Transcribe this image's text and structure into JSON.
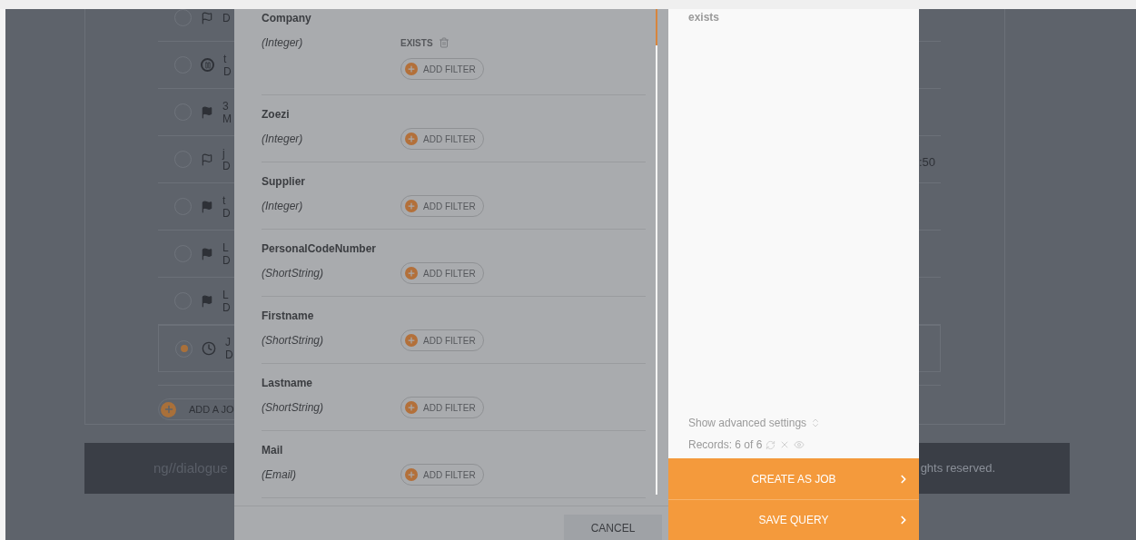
{
  "background_page": {
    "jobs": [
      {
        "kind": "flag",
        "selected": false,
        "subtitle": "D"
      },
      {
        "kind": "pause",
        "selected": false,
        "title": "t",
        "subtitle": "D"
      },
      {
        "kind": "checkered-flag",
        "selected": false,
        "title": "3",
        "subtitle": "M"
      },
      {
        "kind": "flag",
        "selected": false,
        "title": "j",
        "subtitle": "D"
      },
      {
        "kind": "checkered-flag",
        "selected": false,
        "title": "t",
        "subtitle": "D"
      },
      {
        "kind": "checkered-flag",
        "selected": false,
        "title": "L",
        "subtitle": "D"
      },
      {
        "kind": "checkered-flag",
        "selected": false,
        "title": "L",
        "subtitle": "D"
      },
      {
        "kind": "clock",
        "selected": true,
        "title": "J",
        "subtitle": "D"
      }
    ],
    "add_job_button": "ADD A JO",
    "time_fragment": ":50",
    "footer": {
      "logo": "ng//dialogue",
      "copyright": "ghts reserved."
    }
  },
  "modal": {
    "fields": [
      {
        "name": "Company",
        "type": "(Integer)",
        "filters": [
          "EXISTS"
        ],
        "add_filter": "ADD FILTER"
      },
      {
        "name": "Zoezi",
        "type": "(Integer)",
        "add_filter": "ADD FILTER"
      },
      {
        "name": "Supplier",
        "type": "(Integer)",
        "add_filter": "ADD FILTER"
      },
      {
        "name": "PersonalCodeNumber",
        "type": "(ShortString)",
        "add_filter": "ADD FILTER"
      },
      {
        "name": "Firstname",
        "type": "(ShortString)",
        "add_filter": "ADD FILTER"
      },
      {
        "name": "Lastname",
        "type": "(ShortString)",
        "add_filter": "ADD FILTER"
      },
      {
        "name": "Mail",
        "type": "(Email)",
        "add_filter": "ADD FILTER"
      }
    ],
    "cancel_button": "CANCEL",
    "summary": {
      "query_text": "exists",
      "advanced_settings": "Show advanced settings",
      "records": "Records: 6 of 6"
    },
    "actions": [
      "CREATE AS JOB",
      "SAVE QUERY"
    ]
  }
}
